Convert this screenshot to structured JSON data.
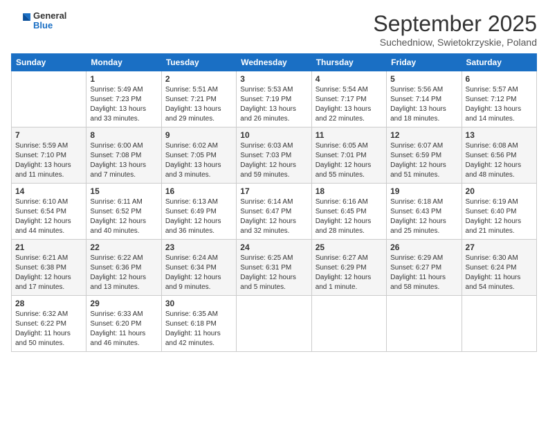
{
  "header": {
    "logo": {
      "general": "General",
      "blue": "Blue"
    },
    "title": "September 2025",
    "subtitle": "Suchedniow, Swietokrzyskie, Poland"
  },
  "days_of_week": [
    "Sunday",
    "Monday",
    "Tuesday",
    "Wednesday",
    "Thursday",
    "Friday",
    "Saturday"
  ],
  "weeks": [
    [
      {
        "day": "",
        "info": ""
      },
      {
        "day": "1",
        "info": "Sunrise: 5:49 AM\nSunset: 7:23 PM\nDaylight: 13 hours\nand 33 minutes."
      },
      {
        "day": "2",
        "info": "Sunrise: 5:51 AM\nSunset: 7:21 PM\nDaylight: 13 hours\nand 29 minutes."
      },
      {
        "day": "3",
        "info": "Sunrise: 5:53 AM\nSunset: 7:19 PM\nDaylight: 13 hours\nand 26 minutes."
      },
      {
        "day": "4",
        "info": "Sunrise: 5:54 AM\nSunset: 7:17 PM\nDaylight: 13 hours\nand 22 minutes."
      },
      {
        "day": "5",
        "info": "Sunrise: 5:56 AM\nSunset: 7:14 PM\nDaylight: 13 hours\nand 18 minutes."
      },
      {
        "day": "6",
        "info": "Sunrise: 5:57 AM\nSunset: 7:12 PM\nDaylight: 13 hours\nand 14 minutes."
      }
    ],
    [
      {
        "day": "7",
        "info": "Sunrise: 5:59 AM\nSunset: 7:10 PM\nDaylight: 13 hours\nand 11 minutes."
      },
      {
        "day": "8",
        "info": "Sunrise: 6:00 AM\nSunset: 7:08 PM\nDaylight: 13 hours\nand 7 minutes."
      },
      {
        "day": "9",
        "info": "Sunrise: 6:02 AM\nSunset: 7:05 PM\nDaylight: 13 hours\nand 3 minutes."
      },
      {
        "day": "10",
        "info": "Sunrise: 6:03 AM\nSunset: 7:03 PM\nDaylight: 12 hours\nand 59 minutes."
      },
      {
        "day": "11",
        "info": "Sunrise: 6:05 AM\nSunset: 7:01 PM\nDaylight: 12 hours\nand 55 minutes."
      },
      {
        "day": "12",
        "info": "Sunrise: 6:07 AM\nSunset: 6:59 PM\nDaylight: 12 hours\nand 51 minutes."
      },
      {
        "day": "13",
        "info": "Sunrise: 6:08 AM\nSunset: 6:56 PM\nDaylight: 12 hours\nand 48 minutes."
      }
    ],
    [
      {
        "day": "14",
        "info": "Sunrise: 6:10 AM\nSunset: 6:54 PM\nDaylight: 12 hours\nand 44 minutes."
      },
      {
        "day": "15",
        "info": "Sunrise: 6:11 AM\nSunset: 6:52 PM\nDaylight: 12 hours\nand 40 minutes."
      },
      {
        "day": "16",
        "info": "Sunrise: 6:13 AM\nSunset: 6:49 PM\nDaylight: 12 hours\nand 36 minutes."
      },
      {
        "day": "17",
        "info": "Sunrise: 6:14 AM\nSunset: 6:47 PM\nDaylight: 12 hours\nand 32 minutes."
      },
      {
        "day": "18",
        "info": "Sunrise: 6:16 AM\nSunset: 6:45 PM\nDaylight: 12 hours\nand 28 minutes."
      },
      {
        "day": "19",
        "info": "Sunrise: 6:18 AM\nSunset: 6:43 PM\nDaylight: 12 hours\nand 25 minutes."
      },
      {
        "day": "20",
        "info": "Sunrise: 6:19 AM\nSunset: 6:40 PM\nDaylight: 12 hours\nand 21 minutes."
      }
    ],
    [
      {
        "day": "21",
        "info": "Sunrise: 6:21 AM\nSunset: 6:38 PM\nDaylight: 12 hours\nand 17 minutes."
      },
      {
        "day": "22",
        "info": "Sunrise: 6:22 AM\nSunset: 6:36 PM\nDaylight: 12 hours\nand 13 minutes."
      },
      {
        "day": "23",
        "info": "Sunrise: 6:24 AM\nSunset: 6:34 PM\nDaylight: 12 hours\nand 9 minutes."
      },
      {
        "day": "24",
        "info": "Sunrise: 6:25 AM\nSunset: 6:31 PM\nDaylight: 12 hours\nand 5 minutes."
      },
      {
        "day": "25",
        "info": "Sunrise: 6:27 AM\nSunset: 6:29 PM\nDaylight: 12 hours\nand 1 minute."
      },
      {
        "day": "26",
        "info": "Sunrise: 6:29 AM\nSunset: 6:27 PM\nDaylight: 11 hours\nand 58 minutes."
      },
      {
        "day": "27",
        "info": "Sunrise: 6:30 AM\nSunset: 6:24 PM\nDaylight: 11 hours\nand 54 minutes."
      }
    ],
    [
      {
        "day": "28",
        "info": "Sunrise: 6:32 AM\nSunset: 6:22 PM\nDaylight: 11 hours\nand 50 minutes."
      },
      {
        "day": "29",
        "info": "Sunrise: 6:33 AM\nSunset: 6:20 PM\nDaylight: 11 hours\nand 46 minutes."
      },
      {
        "day": "30",
        "info": "Sunrise: 6:35 AM\nSunset: 6:18 PM\nDaylight: 11 hours\nand 42 minutes."
      },
      {
        "day": "",
        "info": ""
      },
      {
        "day": "",
        "info": ""
      },
      {
        "day": "",
        "info": ""
      },
      {
        "day": "",
        "info": ""
      }
    ]
  ]
}
